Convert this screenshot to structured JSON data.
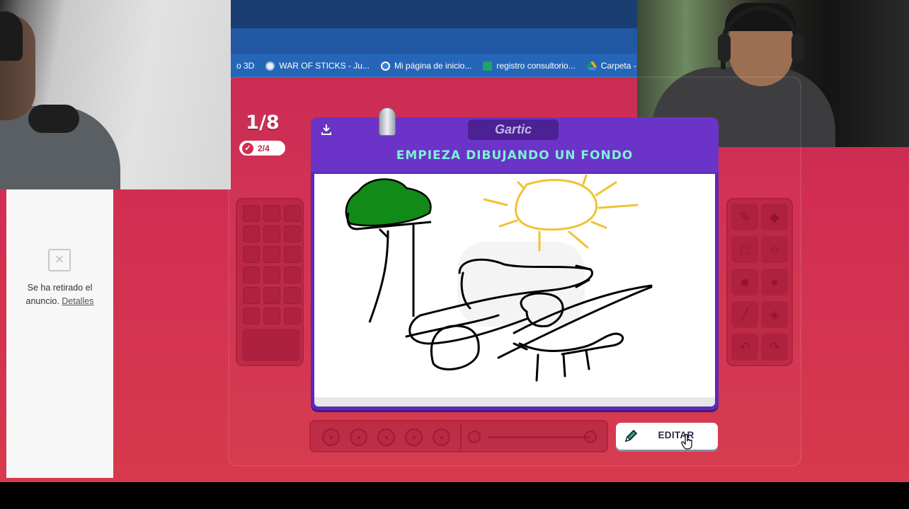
{
  "browser": {
    "bookmarks": [
      {
        "label": "o 3D",
        "icon": "none",
        "color": ""
      },
      {
        "label": "WAR OF STICKS - Ju...",
        "icon": "globe-icon",
        "color": "#e8eef8"
      },
      {
        "label": "Mi página de inicio...",
        "icon": "wordpress-icon",
        "color": "#3a7fd5"
      },
      {
        "label": "registro consultorio...",
        "icon": "sheets-icon",
        "color": "#1fa463"
      },
      {
        "label": "Carpeta - Googl",
        "icon": "drive-icon",
        "color": "#f4b400"
      }
    ]
  },
  "ad": {
    "message": "Se ha retirado el anuncio.",
    "details_link": "Detalles"
  },
  "game": {
    "round": "1/8",
    "substep": "2/4",
    "brand": "Gartic",
    "instruction": "EMPIEZA DIBUJANDO UN FONDO",
    "edit_button": "EDITAR",
    "colors": {
      "background": "#d12e52",
      "card": "#5d2ab3",
      "title": "#7ef0d8"
    },
    "left_tools": {
      "rows": 6,
      "cols": 3
    },
    "right_tools": [
      "pencil-icon",
      "eraser-icon",
      "square-outline-icon",
      "circle-outline-icon",
      "square-fill-icon",
      "circle-fill-icon",
      "line-icon",
      "bucket-icon",
      "undo-icon",
      "redo-icon"
    ],
    "brush_sizes": 5
  }
}
